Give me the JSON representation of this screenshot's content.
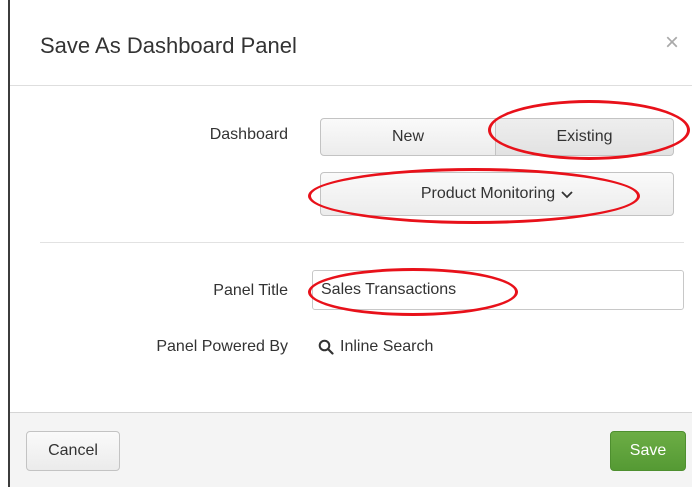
{
  "dialog": {
    "title": "Save As Dashboard Panel",
    "close_glyph": "×"
  },
  "form": {
    "dashboard_label": "Dashboard",
    "new_label": "New",
    "existing_label": "Existing",
    "existing_selected": true,
    "dashboard_select_value": "Product Monitoring",
    "panel_title_label": "Panel Title",
    "panel_title_value": "Sales Transactions",
    "powered_by_label": "Panel Powered By",
    "powered_by_value": "Inline Search",
    "powered_by_icon": "search-icon"
  },
  "footer": {
    "cancel_label": "Cancel",
    "save_label": "Save"
  },
  "colors": {
    "save_button": "#5fa53b",
    "annotation": "#e8111a",
    "footer_bg": "#f4f4f4"
  }
}
